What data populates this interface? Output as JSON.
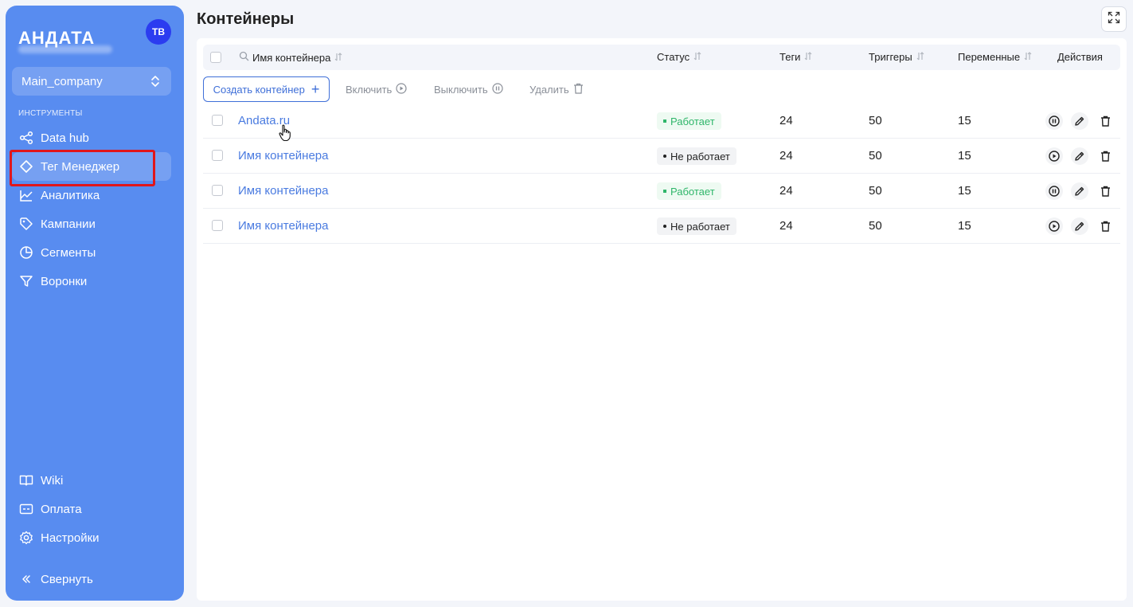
{
  "sidebar": {
    "logo": "АНДАТА",
    "avatar_initials": "ТВ",
    "company": "Main_company",
    "section_label": "ИНСТРУМЕНТЫ",
    "items": [
      {
        "label": "Data hub",
        "icon": "share-icon"
      },
      {
        "label": "Тег Менеджер",
        "icon": "diamond-icon",
        "active": true
      },
      {
        "label": "Аналитика",
        "icon": "chart-line-icon"
      },
      {
        "label": "Кампании",
        "icon": "tag-icon"
      },
      {
        "label": "Сегменты",
        "icon": "pie-chart-icon"
      },
      {
        "label": "Воронки",
        "icon": "filter-icon"
      }
    ],
    "bottom_items": [
      {
        "label": "Wiki",
        "icon": "book-icon"
      },
      {
        "label": "Оплата",
        "icon": "card-icon"
      },
      {
        "label": "Настройки",
        "icon": "gear-icon"
      }
    ],
    "collapse_label": "Свернуть"
  },
  "main": {
    "title": "Контейнеры",
    "table": {
      "columns": [
        "Имя контейнера",
        "Статус",
        "Теги",
        "Триггеры",
        "Переменные",
        "Действия"
      ],
      "rows": [
        {
          "name": "Andata.ru",
          "status": "Работает",
          "active": true,
          "tags": "24",
          "triggers": "50",
          "variables": "15"
        },
        {
          "name": "Имя контейнера",
          "status": "Не работает",
          "active": false,
          "tags": "24",
          "triggers": "50",
          "variables": "15"
        },
        {
          "name": "Имя контейнера",
          "status": "Работает",
          "active": true,
          "tags": "24",
          "triggers": "50",
          "variables": "15"
        },
        {
          "name": "Имя контейнера",
          "status": "Не работает",
          "active": false,
          "tags": "24",
          "triggers": "50",
          "variables": "15"
        }
      ]
    },
    "toolbar": {
      "create_label": "Создать контейнер",
      "enable_label": "Включить",
      "disable_label": "Выключить",
      "delete_label": "Удалить"
    }
  },
  "colors": {
    "sidebar_bg": "#588cf0",
    "accent": "#3f6fd8",
    "status_on": "#2fb66a",
    "highlight": "#e0161b"
  }
}
